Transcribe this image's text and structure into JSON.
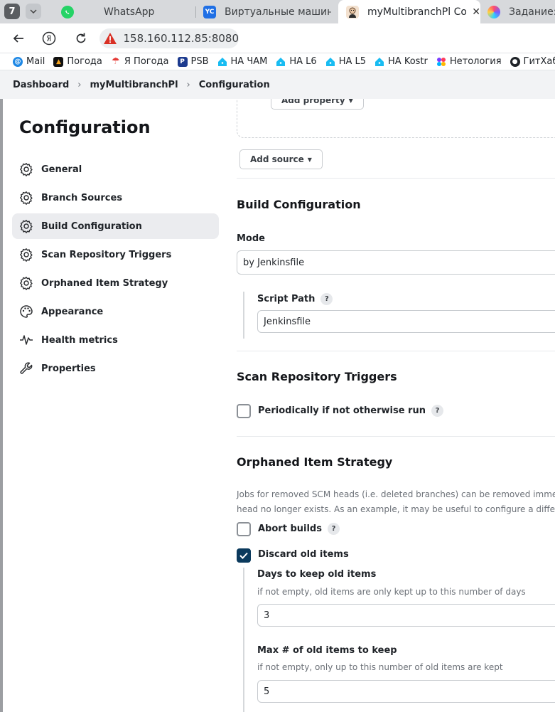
{
  "browser": {
    "tab_count": "7",
    "tabs": [
      {
        "title": "WhatsApp"
      },
      {
        "title": "Виртуальные машины | Y"
      },
      {
        "title": "myMultibranchPl Config"
      },
      {
        "title": "Задание: Д"
      }
    ],
    "url": "158.160.112.85:8080",
    "bookmarks": [
      "Mail",
      "Погода",
      "Я Погода",
      "PSB",
      "НА ЧАМ",
      "НА L6",
      "НА L5",
      "НА Kostr",
      "Нетология",
      "ГитХаб"
    ],
    "colors": {
      "warning": "#d93025",
      "whatsapp": "#25d366",
      "yandex_cloud": "#1f6fe5"
    }
  },
  "breadcrumb": [
    "Dashboard",
    "myMultibranchPl",
    "Configuration"
  ],
  "sidebar": {
    "title": "Configuration",
    "items": [
      {
        "label": "General",
        "icon": "gear-icon"
      },
      {
        "label": "Branch Sources",
        "icon": "gear-icon"
      },
      {
        "label": "Build Configuration",
        "icon": "gear-icon",
        "active": true
      },
      {
        "label": "Scan Repository Triggers",
        "icon": "gear-icon"
      },
      {
        "label": "Orphaned Item Strategy",
        "icon": "gear-icon"
      },
      {
        "label": "Appearance",
        "icon": "palette-icon"
      },
      {
        "label": "Health metrics",
        "icon": "pulse-icon"
      },
      {
        "label": "Properties",
        "icon": "wrench-icon"
      }
    ]
  },
  "main": {
    "add_property_label": "Add property",
    "add_source_label": "Add source",
    "build_configuration": {
      "title": "Build Configuration",
      "mode_label": "Mode",
      "mode_value": "by Jenkinsfile",
      "script_path_label": "Script Path",
      "script_path_value": "Jenkinsfile",
      "help": "?"
    },
    "scan_triggers": {
      "title": "Scan Repository Triggers",
      "periodic_label": "Periodically if not otherwise run",
      "periodic_checked": false,
      "help": "?"
    },
    "orphaned": {
      "title": "Orphaned Item Strategy",
      "desc_line1": "Jobs for removed SCM heads (i.e. deleted branches) can be removed immediate",
      "desc_line2": "head no longer exists. As an example, it may be useful to configure a different r",
      "abort_label": "Abort builds",
      "abort_checked": false,
      "discard_label": "Discard old items",
      "discard_checked": true,
      "days_label": "Days to keep old items",
      "days_desc": "if not empty, old items are only kept up to this number of days",
      "days_value": "3",
      "max_label": "Max # of old items to keep",
      "max_desc": "if not empty, only up to this number of old items are kept",
      "max_value": "5",
      "help": "?"
    },
    "colors": {
      "checkbox_on": "#0b3a5d"
    }
  }
}
